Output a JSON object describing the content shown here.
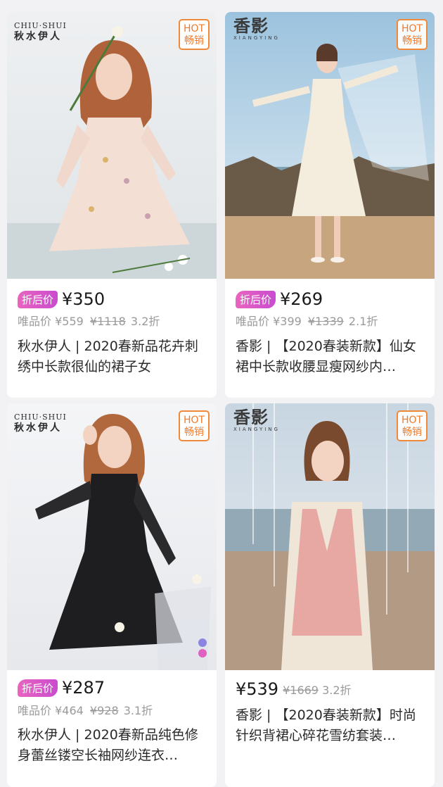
{
  "cards": [
    {
      "brand_en": "CHIU·SHUI",
      "brand_cn": "秋水伊人",
      "hot_en": "HOT",
      "hot_cn": "畅销",
      "badge": "折后价",
      "price": "¥350",
      "vip_label": "唯品价",
      "vip_price": "¥559",
      "orig_price": "¥1118",
      "discount": "3.2折",
      "title": "秋水伊人 | 2020春新品花卉刺绣中长款很仙的裙子女"
    },
    {
      "brand_cn": "香影",
      "brand_en": "XIANGYING",
      "hot_en": "HOT",
      "hot_cn": "畅销",
      "badge": "折后价",
      "price": "¥269",
      "vip_label": "唯品价",
      "vip_price": "¥399",
      "orig_price": "¥1339",
      "discount": "2.1折",
      "title": "香影 | 【2020春装新款】仙女裙中长款收腰显瘦网纱内…"
    },
    {
      "brand_en": "CHIU·SHUI",
      "brand_cn": "秋水伊人",
      "hot_en": "HOT",
      "hot_cn": "畅销",
      "badge": "折后价",
      "price": "¥287",
      "vip_label": "唯品价",
      "vip_price": "¥464",
      "orig_price": "¥928",
      "discount": "3.1折",
      "title": "秋水伊人 | 2020春新品纯色修身蕾丝镂空长袖网纱连衣…"
    },
    {
      "brand_cn": "香影",
      "brand_en": "XIANGYING",
      "hot_en": "HOT",
      "hot_cn": "畅销",
      "price": "¥539",
      "orig_price": "¥1669",
      "discount": "3.2折",
      "title": "香影 | 【2020春装新款】时尚针织背裙心碎花雪纺套装…"
    }
  ]
}
